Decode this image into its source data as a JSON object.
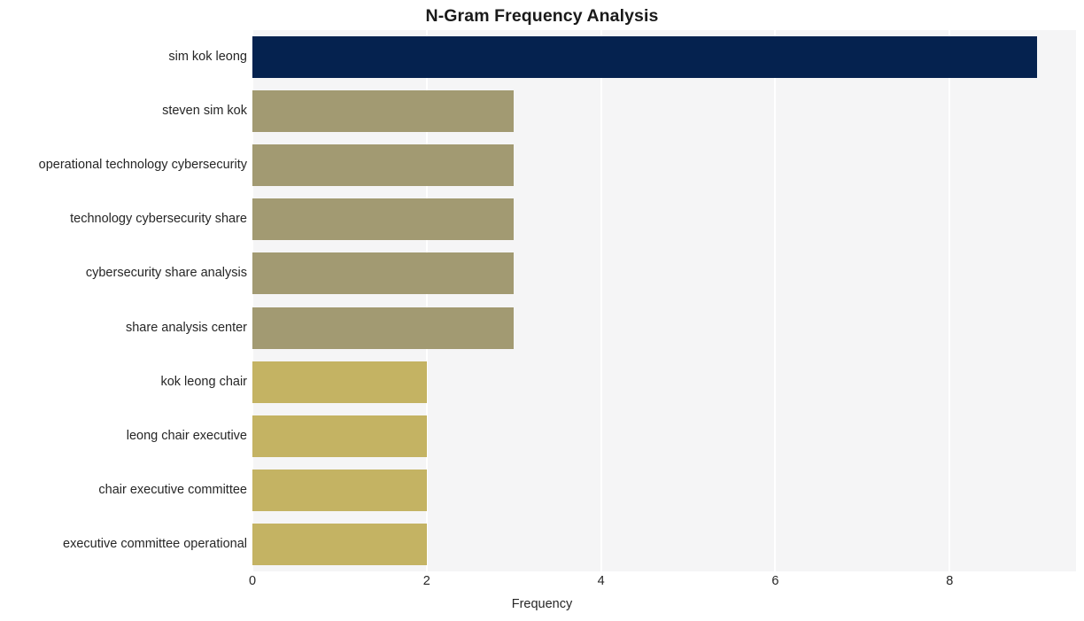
{
  "chart_data": {
    "type": "bar",
    "orientation": "horizontal",
    "title": "N-Gram Frequency Analysis",
    "xlabel": "Frequency",
    "ylabel": "",
    "categories": [
      "sim kok leong",
      "steven sim kok",
      "operational technology cybersecurity",
      "technology cybersecurity share",
      "cybersecurity share analysis",
      "share analysis center",
      "kok leong chair",
      "leong chair executive",
      "chair executive committee",
      "executive committee operational"
    ],
    "values": [
      9,
      3,
      3,
      3,
      3,
      3,
      2,
      2,
      2,
      2
    ],
    "bar_colors": [
      "#05224f",
      "#a29a72",
      "#a29a72",
      "#a29a72",
      "#a29a72",
      "#a29a72",
      "#c4b363",
      "#c4b363",
      "#c4b363",
      "#c4b363"
    ],
    "xlim": [
      0,
      9.45
    ],
    "xticks": [
      0,
      2,
      4,
      6,
      8
    ],
    "xtick_labels": [
      "0",
      "2",
      "4",
      "6",
      "8"
    ],
    "grid": true,
    "grid_axis": "x",
    "grid_color": "#ffffff",
    "plot_background": "#f5f5f6",
    "figure_background": "#ffffff",
    "legend": null,
    "legend_position": "none"
  }
}
